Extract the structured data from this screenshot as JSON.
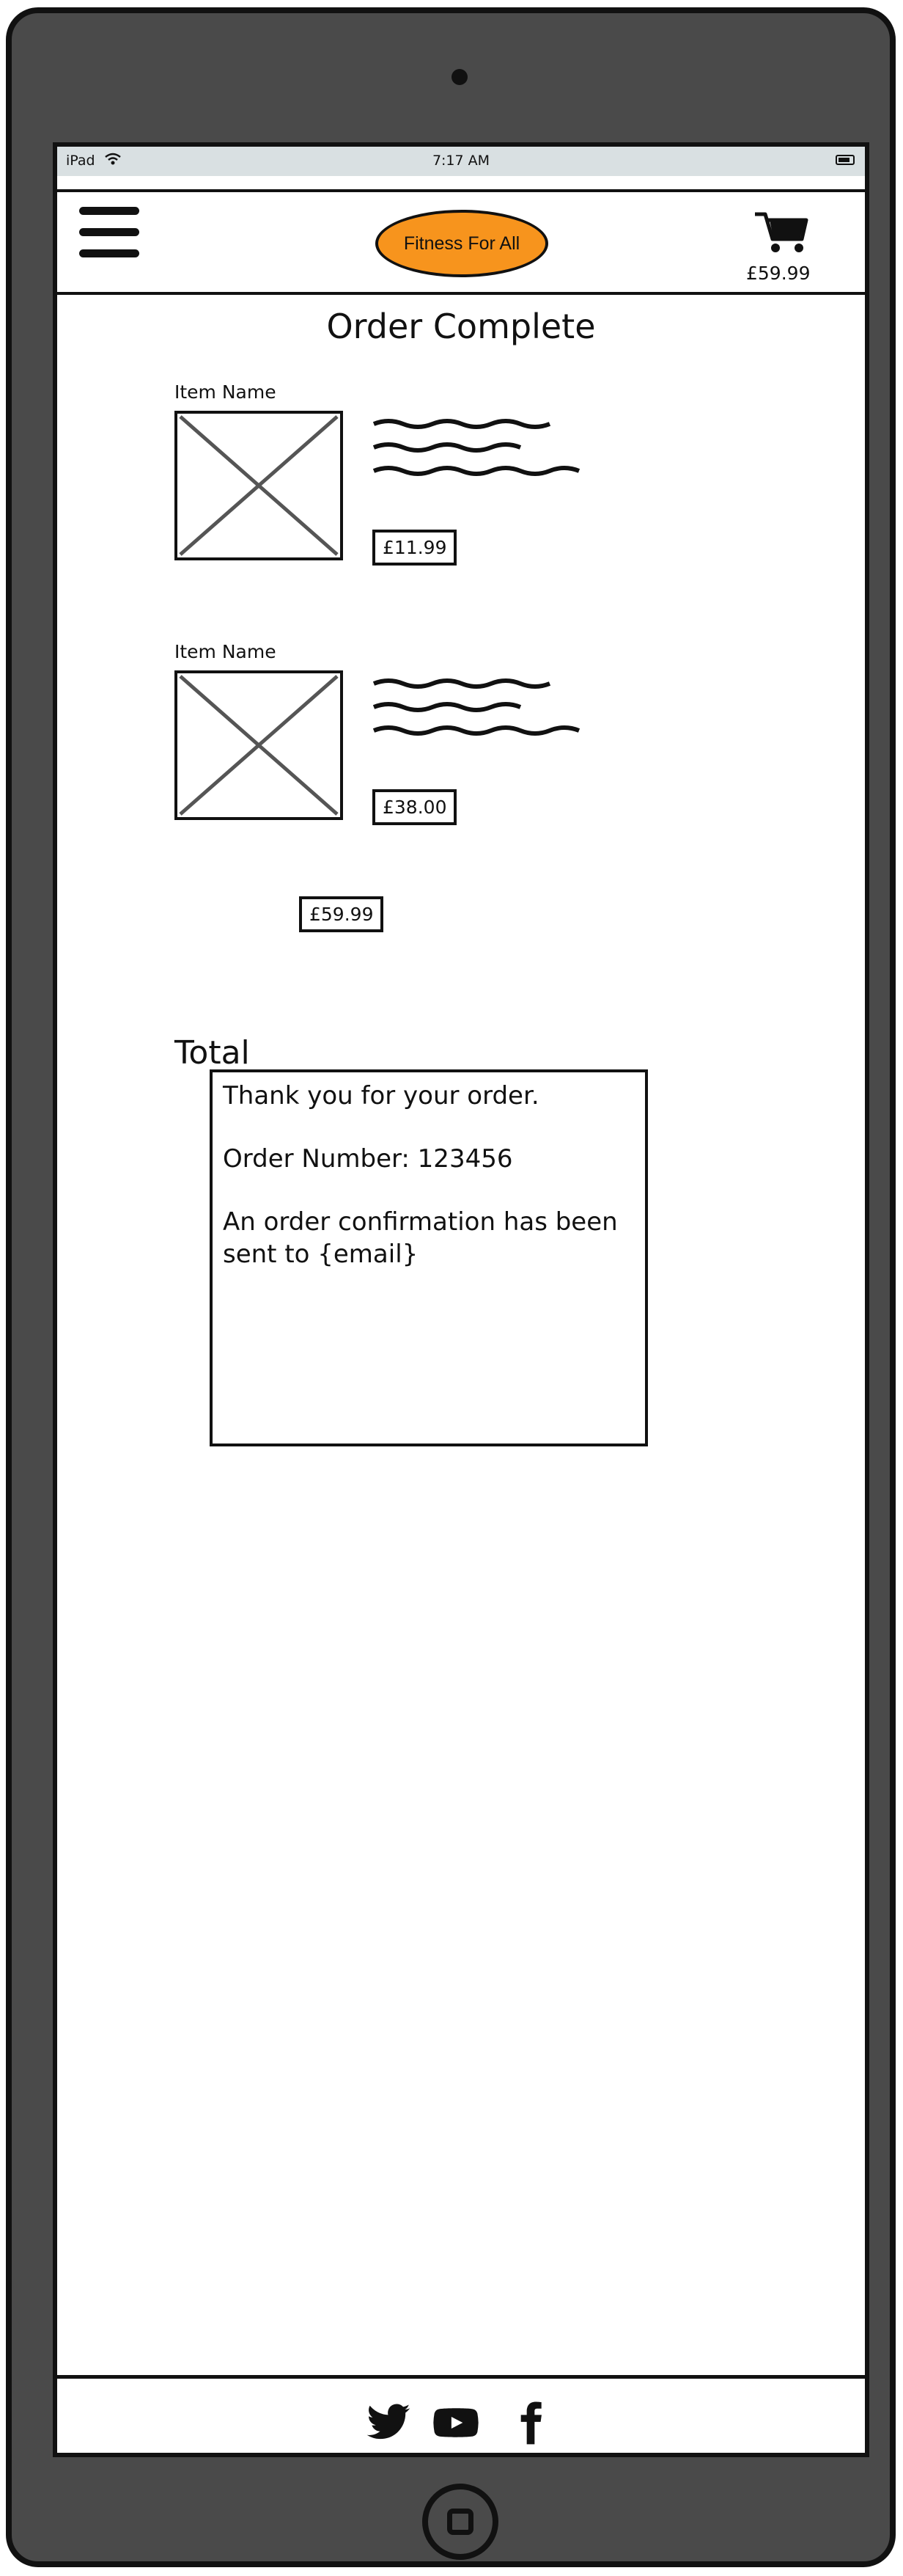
{
  "status_bar": {
    "carrier": "iPad",
    "time": "7:17 AM"
  },
  "header": {
    "menu_icon": "hamburger-menu-icon",
    "logo_text": "Fitness For All",
    "cart_icon": "shopping-cart-icon",
    "cart_total": "£59.99",
    "logo_color": "#f7941d"
  },
  "page": {
    "title": "Order Complete"
  },
  "order_items": [
    {
      "name": "Item Name",
      "price": "£11.99",
      "image_icon": "image-placeholder-icon"
    },
    {
      "name": "Item Name",
      "price": "£38.00",
      "image_icon": "image-placeholder-icon"
    }
  ],
  "total": {
    "label": "Total",
    "value": "£59.99"
  },
  "confirmation": {
    "thanks": "Thank you for your order.",
    "order_number": "Order Number: 123456",
    "email_notice": "An order confirmation has been sent to {email}"
  },
  "footer": {
    "icons": [
      "twitter-icon",
      "youtube-icon",
      "facebook-icon"
    ]
  }
}
